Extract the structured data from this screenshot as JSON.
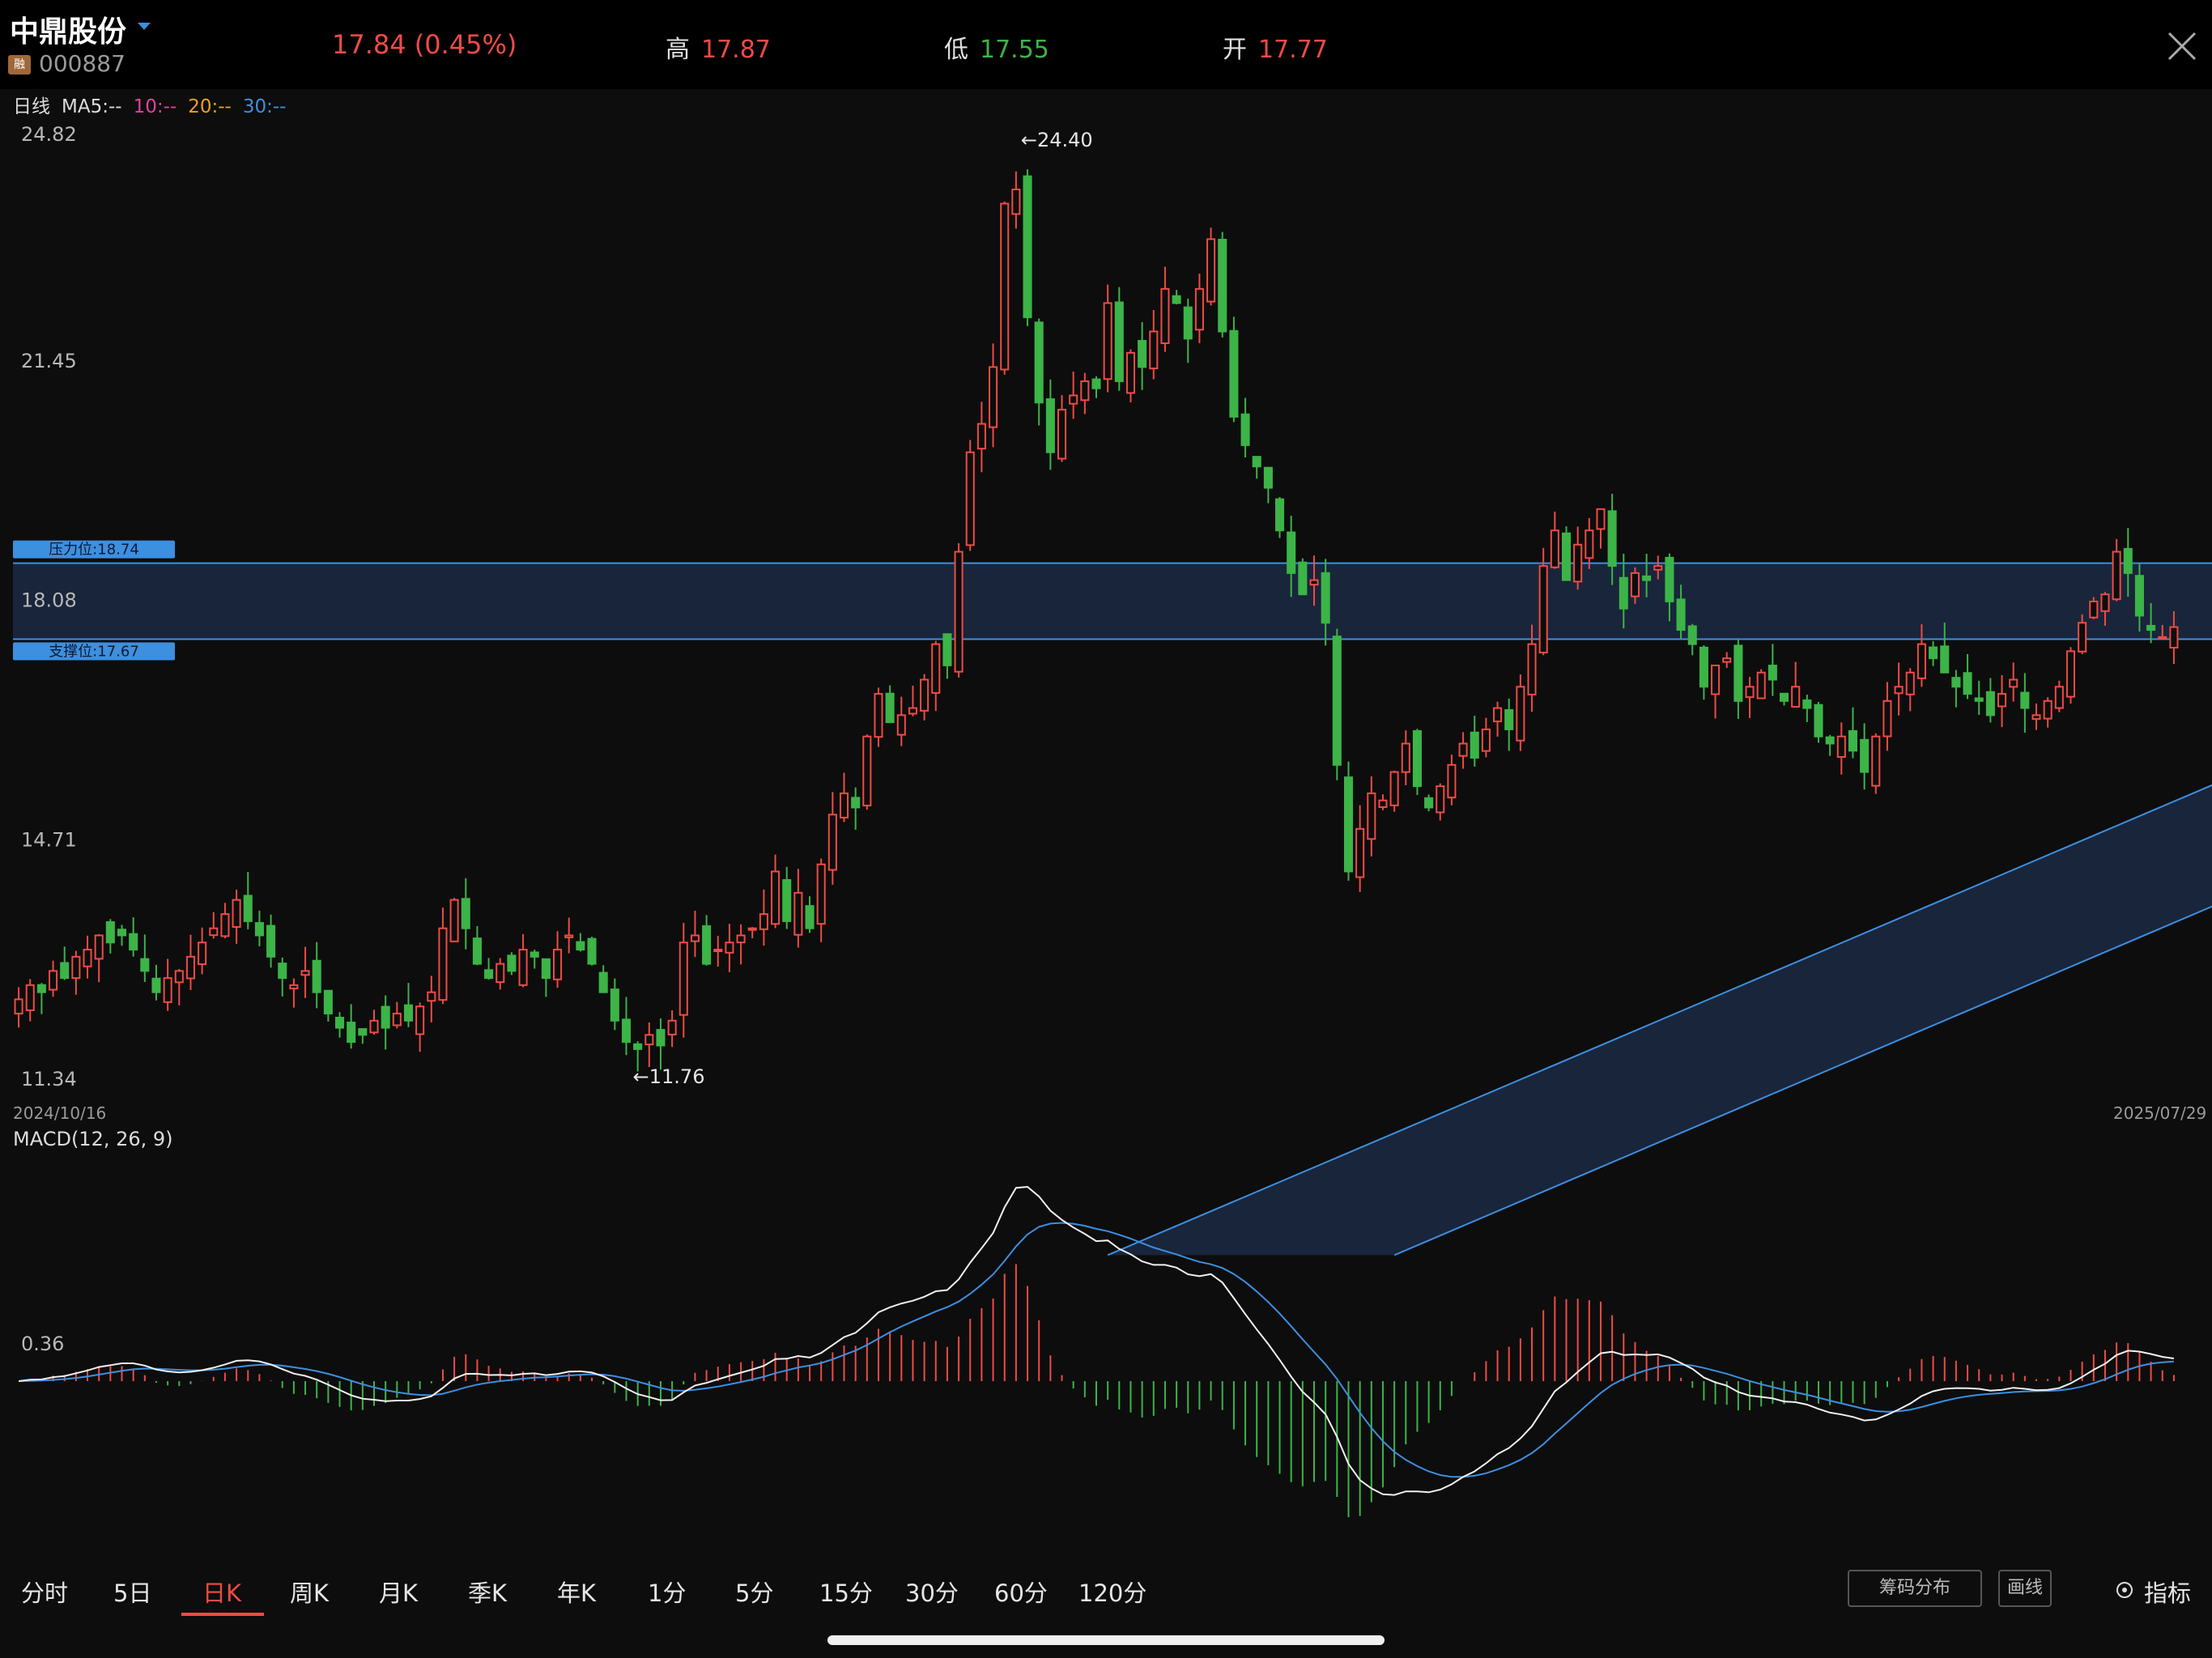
{
  "header": {
    "stock_name": "中鼎股份",
    "badge": "融",
    "stock_code": "000887",
    "price_change": "17.84 (0.45%)",
    "high_label": "高",
    "high_value": "17.87",
    "low_label": "低",
    "low_value": "17.55",
    "open_label": "开",
    "open_value": "17.77"
  },
  "ma_legend": {
    "period": "日线",
    "ma5": "MA5:--",
    "ma10": "10:--",
    "ma20": "20:--",
    "ma30": "30:--"
  },
  "colors": {
    "up": "#ef4b45",
    "down": "#3cb447",
    "ma10": "#e040a0",
    "ma20": "#f0a020",
    "ma30": "#3d8fe0",
    "channel": "#3d8fe0",
    "dif": "#f0f0f0",
    "dea": "#3d8fe0"
  },
  "chart_data": {
    "type": "candlestick",
    "y_ticks": [
      "24.82",
      "21.45",
      "18.08",
      "14.71",
      "11.34"
    ],
    "ylim": [
      11.34,
      24.82
    ],
    "max_marker": "←24.40",
    "min_marker": "←11.76",
    "resistance_label": "压力位:18.74",
    "support_label": "支撑位:17.67",
    "resistance": 18.74,
    "support": 17.67,
    "start_date": "2024/10/16",
    "end_date": "2025/07/29",
    "channel": {
      "upper": [
        [
          95,
          9.0
        ],
        [
          245,
          19.3
        ]
      ],
      "lower": [
        [
          120,
          9.0
        ],
        [
          245,
          17.6
        ]
      ]
    },
    "closes": [
      12.6,
      12.8,
      12.7,
      13.0,
      12.9,
      13.2,
      13.3,
      13.5,
      13.4,
      13.5,
      13.3,
      13.0,
      12.7,
      12.9,
      13.0,
      13.2,
      13.4,
      13.6,
      13.8,
      14.0,
      13.7,
      13.5,
      13.2,
      12.9,
      12.8,
      13.0,
      12.7,
      12.4,
      12.2,
      12.0,
      12.1,
      12.3,
      12.2,
      12.4,
      12.3,
      12.5,
      12.7,
      13.6,
      14.0,
      13.6,
      13.1,
      12.9,
      13.1,
      13.0,
      13.3,
      13.2,
      12.9,
      13.3,
      13.5,
      13.3,
      13.1,
      12.7,
      12.3,
      12.0,
      11.9,
      12.1,
      11.95,
      12.3,
      13.4,
      13.5,
      13.1,
      13.3,
      13.4,
      13.5,
      13.6,
      13.8,
      14.4,
      13.7,
      14.1,
      13.6,
      14.5,
      15.2,
      15.5,
      15.3,
      16.3,
      16.9,
      16.5,
      16.6,
      16.7,
      17.1,
      17.6,
      17.3,
      18.9,
      20.3,
      20.7,
      21.5,
      23.8,
      24.0,
      22.2,
      21.0,
      20.3,
      20.9,
      21.1,
      21.3,
      21.2,
      22.4,
      21.3,
      21.7,
      21.5,
      22.0,
      22.6,
      22.4,
      21.9,
      22.6,
      23.3,
      22.0,
      20.8,
      20.4,
      20.1,
      19.8,
      19.2,
      18.6,
      18.3,
      18.5,
      17.9,
      15.9,
      14.4,
      15.0,
      15.5,
      15.4,
      15.8,
      16.2,
      15.6,
      15.3,
      15.6,
      15.9,
      16.2,
      16.0,
      16.4,
      16.7,
      16.4,
      17.0,
      17.6,
      18.7,
      19.2,
      18.5,
      19.0,
      19.2,
      19.5,
      18.7,
      18.1,
      18.6,
      18.5,
      18.7,
      18.2,
      17.8,
      17.6,
      17.0,
      17.3,
      17.4,
      16.8,
      17.0,
      17.2,
      17.1,
      16.8,
      17.0,
      16.7,
      16.3,
      16.2,
      16.3,
      16.1,
      15.8,
      16.3,
      16.8,
      17.0,
      17.2,
      17.6,
      17.4,
      17.2,
      17.0,
      16.9,
      16.8,
      16.6,
      16.9,
      17.1,
      16.7,
      16.6,
      16.8,
      17.0,
      17.5,
      17.9,
      18.2,
      18.3,
      18.9,
      18.6,
      18.0,
      17.8,
      17.7,
      17.84
    ]
  },
  "macd": {
    "title": "MACD(12, 26, 9)",
    "tick": "0.36"
  },
  "tabs": [
    "分时",
    "5日",
    "日K",
    "周K",
    "月K",
    "季K",
    "年K",
    "1分",
    "5分",
    "15分",
    "30分",
    "60分",
    "120分"
  ],
  "active_tab": 2,
  "buttons": {
    "chips": "筹码分布",
    "draw": "画线",
    "indicator": "指标"
  }
}
